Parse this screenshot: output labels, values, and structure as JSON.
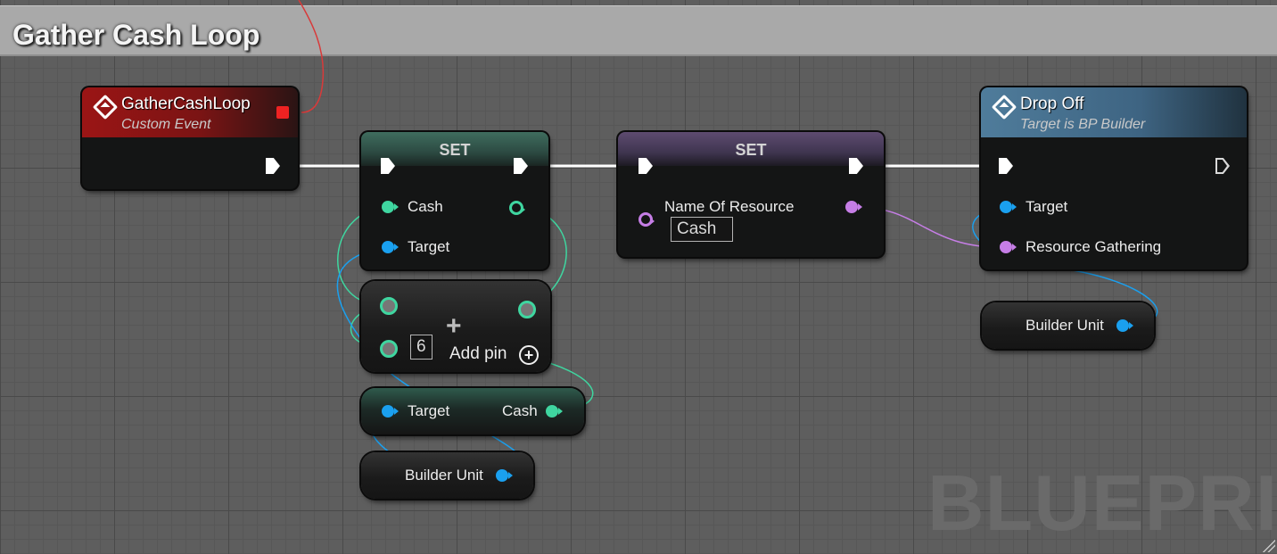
{
  "comment": {
    "title": "Gather Cash Loop"
  },
  "event_node": {
    "title": "GatherCashLoop",
    "subtitle": "Custom Event"
  },
  "set_cash_node": {
    "title": "SET",
    "input_label": "Cash",
    "target_label": "Target"
  },
  "make_array_node": {
    "index_value": "6",
    "add_pin_label": "Add pin"
  },
  "cash_getter_node": {
    "input_label": "Target",
    "output_label": "Cash"
  },
  "builder_unit_left": {
    "label": "Builder Unit"
  },
  "set_name_node": {
    "title": "SET",
    "input_label": "Name Of Resource",
    "input_value": "Cash"
  },
  "drop_off_node": {
    "title": "Drop Off",
    "subtitle": "Target is BP Builder",
    "target_label": "Target",
    "resource_label": "Resource Gathering"
  },
  "builder_unit_right": {
    "label": "Builder Unit"
  },
  "watermark": "BLUEPRIN",
  "colors": {
    "exec": "#ffffff",
    "float_pin": "#3fd6a0",
    "object_pin": "#1aa0ef",
    "name_pin": "#c67ee6",
    "event_header": "#9b1515",
    "function_header": "#4f7c9b"
  }
}
